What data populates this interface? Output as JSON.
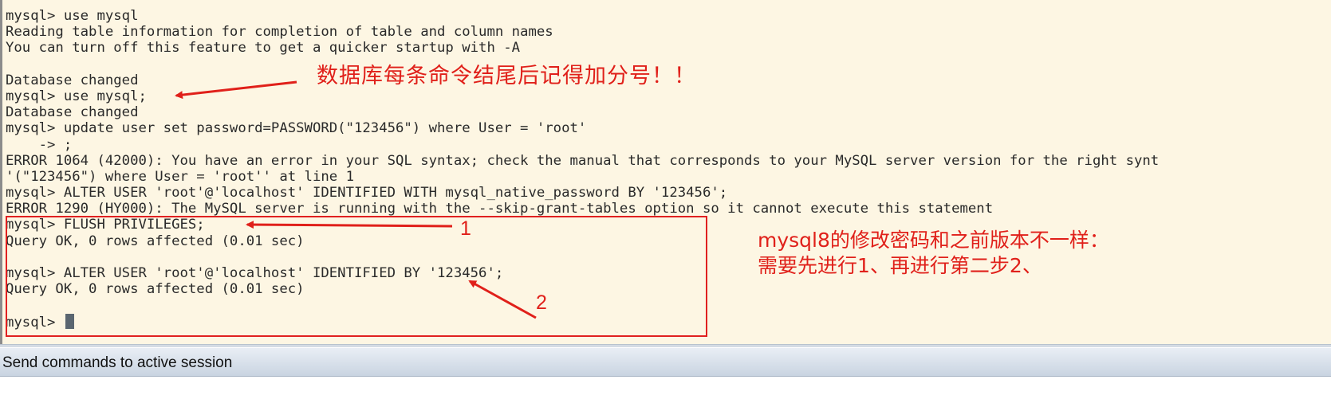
{
  "terminal": {
    "lines": [
      "mysql> use mysql",
      "Reading table information for completion of table and column names",
      "You can turn off this feature to get a quicker startup with -A",
      "",
      "Database changed",
      "mysql> use mysql;",
      "Database changed",
      "mysql> update user set password=PASSWORD(\"123456\") where User = 'root'",
      "    -> ;",
      "ERROR 1064 (42000): You have an error in your SQL syntax; check the manual that corresponds to your MySQL server version for the right synt",
      "'(\"123456\") where User = 'root'' at line 1",
      "mysql> ALTER USER 'root'@'localhost' IDENTIFIED WITH mysql_native_password BY '123456';",
      "ERROR 1290 (HY000): The MySQL server is running with the --skip-grant-tables option so it cannot execute this statement",
      "mysql> FLUSH PRIVILEGES;",
      "Query OK, 0 rows affected (0.01 sec)",
      "",
      "mysql> ALTER USER 'root'@'localhost' IDENTIFIED BY '123456';",
      "Query OK, 0 rows affected (0.01 sec)",
      ""
    ],
    "current_prompt": "mysql> "
  },
  "annotations": {
    "semicolon_note": "数据库每条命令结尾后记得加分号！！",
    "step_1_label": "1",
    "step_2_label": "2",
    "mysql8_note_line1": "mysql8的修改密码和之前版本不一样：",
    "mysql8_note_line2": "需要先进行1、再进行第二步2、",
    "color": "#e0201a"
  },
  "status_bar": {
    "label": "Send commands to active session"
  }
}
